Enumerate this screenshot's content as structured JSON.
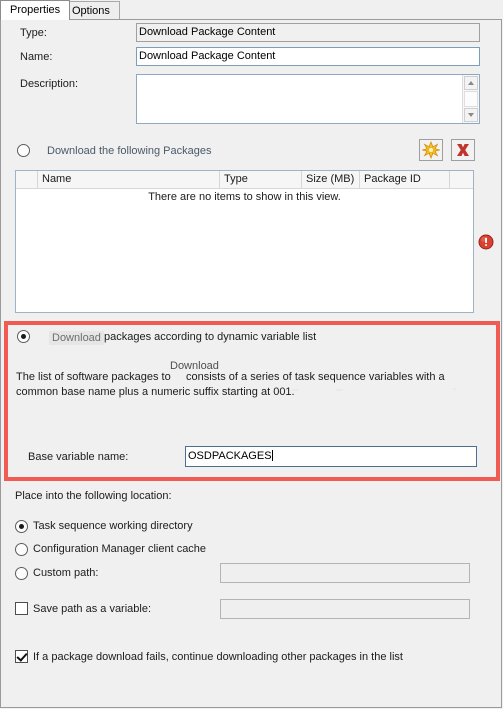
{
  "window": {
    "title": "Download Package Content"
  },
  "tabs": [
    {
      "label": "Properties",
      "active": true
    },
    {
      "label": "Options",
      "active": false
    }
  ],
  "form": {
    "type_label": "Type:",
    "type_value": "Download Package Content",
    "name_label": "Name:",
    "name_value": "Download Package Content",
    "description_label": "Description:",
    "description_value": ""
  },
  "packages_section": {
    "radio_label": "Download the following Packages",
    "radio_selected": false,
    "add_button_icon": "starburst-add-icon",
    "remove_button_icon": "red-x-delete-icon",
    "error_icon": "red-error-exclamation-icon",
    "columns": [
      "Name",
      "Type",
      "Size (MB)",
      "Package ID"
    ],
    "empty_text": "There are no items to show in this view.",
    "rows": []
  },
  "dynamic_section": {
    "radio_label_prefix": "Download",
    "radio_label_rest": "packages according to dynamic variable list",
    "radio_selected": true,
    "description_line1": "The list of software packages to",
    "description_overlap": "Download",
    "description_line1b": "consists of a series of task sequence variables with a",
    "description_line2": "common base name plus a numeric suffix starting at 001.",
    "base_variable_label": "Base variable name:",
    "base_variable_value": "OSDPACKAGES",
    "highlight_color": "#f05b53"
  },
  "location_section": {
    "heading": "Place into the following location:",
    "options": [
      {
        "label": "Task sequence working directory",
        "selected": true
      },
      {
        "label": "Configuration Manager client cache",
        "selected": false
      },
      {
        "label": "Custom path:",
        "selected": false
      }
    ],
    "custom_path_value": "",
    "save_path_checkbox": {
      "label": "Save path as a variable:",
      "checked": false,
      "value": ""
    },
    "continue_checkbox": {
      "label": "If a package download fails, continue downloading other packages in the list",
      "checked": true
    }
  }
}
